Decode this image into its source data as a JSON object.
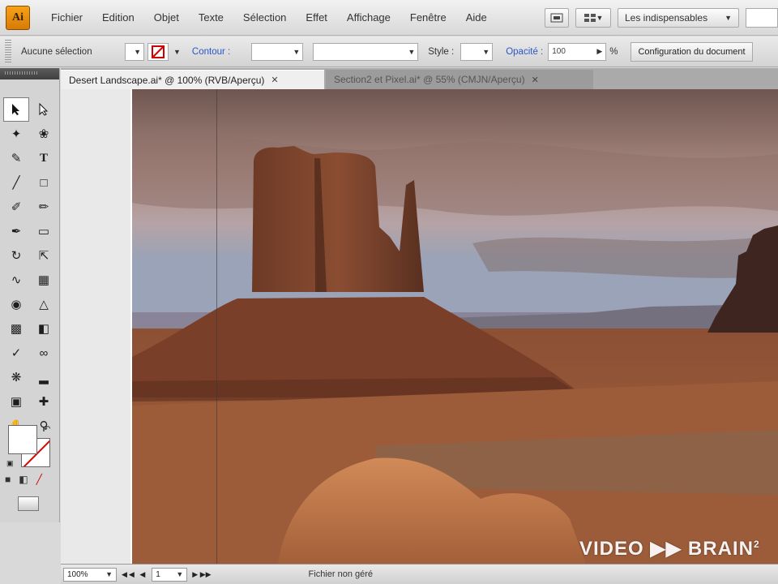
{
  "app": {
    "logo_text": "Ai"
  },
  "menubar": {
    "items": [
      "Fichier",
      "Edition",
      "Objet",
      "Texte",
      "Sélection",
      "Effet",
      "Affichage",
      "Fenêtre",
      "Aide"
    ],
    "workspace": "Les indispensables"
  },
  "controlbar": {
    "selection_status": "Aucune sélection",
    "stroke_label": "Contour :",
    "style_label": "Style :",
    "opacity_label": "Opacité :",
    "opacity_value": "100",
    "opacity_unit": "%",
    "doc_setup_label": "Configuration du document"
  },
  "tabs": [
    {
      "label": "Desert Landscape.ai* @ 100% (RVB/Aperçu)",
      "active": true
    },
    {
      "label": "Section2 et Pixel.ai* @ 55% (CMJN/Aperçu)",
      "active": false
    }
  ],
  "tools": {
    "items": [
      "selection-tool",
      "direct-selection-tool",
      "magic-wand-tool",
      "lasso-tool",
      "pen-tool",
      "type-tool",
      "line-tool",
      "rectangle-tool",
      "paintbrush-tool",
      "pencil-tool",
      "blob-brush-tool",
      "eraser-tool",
      "rotate-tool",
      "scale-tool",
      "warp-tool",
      "free-transform-tool",
      "shape-builder-tool",
      "perspective-grid-tool",
      "mesh-tool",
      "gradient-tool",
      "eyedropper-tool",
      "blend-tool",
      "symbol-sprayer-tool",
      "column-graph-tool",
      "artboard-tool",
      "slice-tool",
      "hand-tool",
      "zoom-tool"
    ]
  },
  "statusbar": {
    "zoom": "100%",
    "page": "1",
    "status_text": "Fichier non géré"
  },
  "watermark": {
    "text": "VIDEO ▶▶ BRAIN",
    "sup": "2"
  },
  "colors": {
    "sky_top": "#6f5650",
    "sky_mid": "#a88980",
    "horizon": "#9aa3b7",
    "butte": "#8a4d32",
    "ground": "#9a5a38",
    "rock_fore": "#c27a4c"
  }
}
